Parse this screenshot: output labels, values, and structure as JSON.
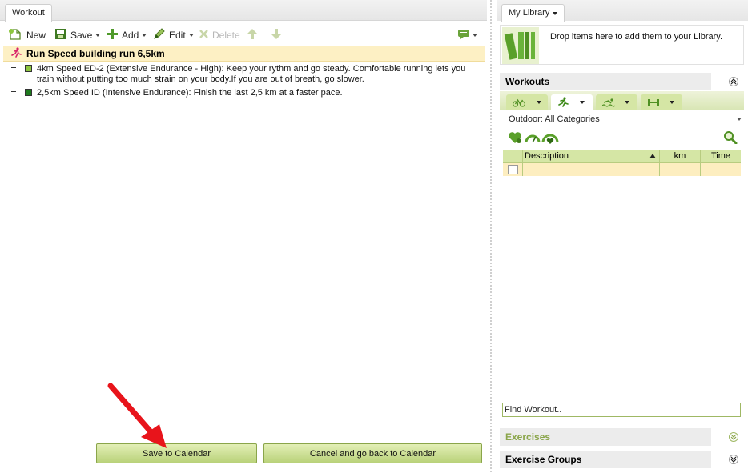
{
  "left_tab": "Workout",
  "toolbar": {
    "new_label": "New",
    "save_label": "Save",
    "add_label": "Add",
    "edit_label": "Edit",
    "delete_label": "Delete"
  },
  "workout": {
    "title": "Run Speed building run 6,5km",
    "steps": [
      {
        "text": "4km Speed ED-2 (Extensive Endurance - High): Keep your rythm and go steady. Comfortable running lets you train without putting too much strain on your body.If you are out of breath, go slower.",
        "color": "#8dc63f"
      },
      {
        "text": "2,5km Speed ID (Intensive Endurance): Finish the last 2,5 km at a faster pace.",
        "color": "#1e7a1e"
      }
    ]
  },
  "buttons": {
    "save_to_calendar": "Save to Calendar",
    "cancel": "Cancel and go back to Calendar"
  },
  "library": {
    "tab_label": "My Library",
    "drop_text": "Drop items here to add them to your Library.",
    "workouts_header": "Workouts",
    "filter_label": "Outdoor: All Categories",
    "columns": [
      "Description",
      "km",
      "Time"
    ],
    "find_placeholder": "Find Workout..",
    "exercises_header": "Exercises",
    "exercise_groups_header": "Exercise Groups"
  },
  "colors": {
    "accent_green": "#8aa54a",
    "highlight_yellow": "#fdf0c4",
    "arrow_red": "#e8141b"
  }
}
